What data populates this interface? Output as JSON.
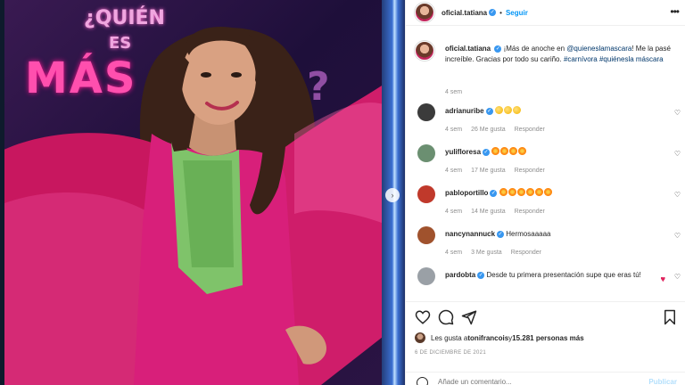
{
  "post": {
    "username": "oficial.tatiana",
    "follow_label": "Seguir",
    "more_icon": "more-options-icon"
  },
  "photo": {
    "sign_question": "¿QUIÉN",
    "sign_es": "ES",
    "sign_mas": "MÁS",
    "sign_qm": "?"
  },
  "caption": {
    "username": "oficial.tatiana",
    "text_1": "¡Más de anoche en ",
    "mention": "@quieneslamascara",
    "text_2": "! Me la pasé increíble. Gracias por todo su cariño. ",
    "hashtags": "#carnívora #quiénesla máscara",
    "ago": "4 sem"
  },
  "comments": [
    {
      "username": "adrianuribe",
      "text": "",
      "emojis": [
        "clap",
        "clap",
        "clap"
      ],
      "time": "4 sem",
      "likes": "26 Me gusta",
      "reply": "Responder",
      "avatar_color": "#3b3b3b"
    },
    {
      "username": "yulifloresa",
      "text": "",
      "emojis": [
        "star",
        "star",
        "star",
        "star"
      ],
      "time": "4 sem",
      "likes": "17 Me gusta",
      "reply": "Responder",
      "avatar_color": "#6b8f71"
    },
    {
      "username": "pabloportillo",
      "text": "",
      "emojis": [
        "star",
        "star",
        "star",
        "star",
        "star",
        "star"
      ],
      "time": "4 sem",
      "likes": "14 Me gusta",
      "reply": "Responder",
      "avatar_color": "#c0392b"
    },
    {
      "username": "nancynannuck",
      "text": "Hermosaaaaa",
      "emojis": [],
      "time": "4 sem",
      "likes": "3 Me gusta",
      "reply": "Responder",
      "avatar_color": "#a0522d"
    },
    {
      "username": "pardobta",
      "text": "Desde tu primera presentación supe que eras tú!",
      "emojis": [
        "heart",
        "heart",
        "heart",
        "heart",
        "heart",
        "heart"
      ],
      "time": "",
      "likes": "",
      "reply": "",
      "avatar_color": "#9aa0a6"
    }
  ],
  "likes": {
    "prefix": "Les gusta a ",
    "user": "tonifrancois",
    "middle": " y ",
    "count": "15.281 personas más"
  },
  "date": "6 DE DICIEMBRE DE 2021",
  "add_comment": {
    "placeholder": "Añade un comentario...",
    "post_label": "Publicar"
  },
  "colors": {
    "accent": "#0095f6",
    "link": "#00376b",
    "muted": "#8e8e8e",
    "dress": "#d81f7a"
  }
}
